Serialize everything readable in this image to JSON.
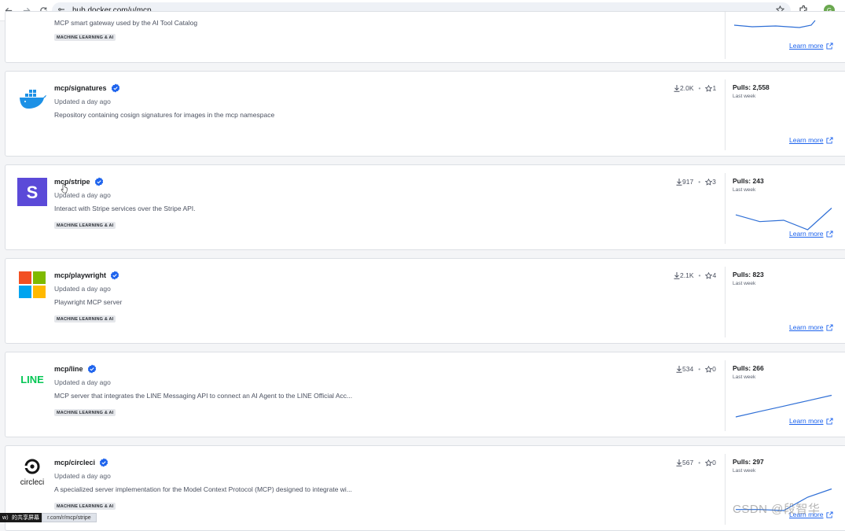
{
  "browser": {
    "url": "hub.docker.com/u/mcp",
    "profile_initial": "G"
  },
  "top_card": {
    "desc_fragment": "MCP smart gateway used by the AI Tool Catalog",
    "tag": "MACHINE LEARNING & AI",
    "learn_more": "Learn more"
  },
  "repos": [
    {
      "name": "mcp/signatures",
      "updated": "Updated a day ago",
      "description": "Repository containing cosign signatures for images in the mcp namespace",
      "tag": "",
      "downloads": "2.0K",
      "stars": "1",
      "pulls": "Pulls: 2,558",
      "period": "Last week",
      "learn_more": "Learn more",
      "logo": "docker-whale-icon",
      "spark": []
    },
    {
      "name": "mcp/stripe",
      "updated": "Updated a day ago",
      "description": "Interact with Stripe services over the Stripe API.",
      "tag": "MACHINE LEARNING & AI",
      "downloads": "917",
      "stars": "3",
      "pulls": "Pulls: 243",
      "period": "Last week",
      "learn_more": "Learn more",
      "logo": "stripe-s-icon",
      "spark": [
        62,
        57,
        58,
        51,
        67
      ]
    },
    {
      "name": "mcp/playwright",
      "updated": "Updated a day ago",
      "description": "Playwright MCP server",
      "tag": "MACHINE LEARNING & AI",
      "downloads": "2.1K",
      "stars": "4",
      "pulls": "Pulls: 823",
      "period": "Last week",
      "learn_more": "Learn more",
      "logo": "microsoft-icon",
      "spark": []
    },
    {
      "name": "mcp/line",
      "updated": "Updated a day ago",
      "description": "MCP server that integrates the LINE Messaging API to connect an AI Agent to the LINE Official Acc...",
      "tag": "MACHINE LEARNING & AI",
      "downloads": "534",
      "stars": "0",
      "pulls": "Pulls: 266",
      "period": "Last week",
      "learn_more": "Learn more",
      "logo": "line-icon",
      "logo_text": "LINE",
      "spark": [
        40,
        45,
        50,
        55,
        60
      ]
    },
    {
      "name": "mcp/circleci",
      "updated": "Updated a day ago",
      "description": "A specialized server implementation for the Model Context Protocol (MCP) designed to integrate wi...",
      "tag": "MACHINE LEARNING & AI",
      "downloads": "567",
      "stars": "0",
      "pulls": "Pulls: 297",
      "period": "Last week",
      "learn_more": "Learn more",
      "logo": "circleci-icon",
      "logo_text": "circleci",
      "spark": [
        40,
        40,
        39,
        52,
        60
      ]
    }
  ],
  "status_bar": {
    "left": "w）的共享屏幕",
    "right": "r.com/r/mcp/stripe"
  },
  "watermark": "CSDN @段智华",
  "colors": {
    "link": "#1d63ed",
    "verified": "#1d63ed",
    "spark": "#2f6fd6"
  }
}
